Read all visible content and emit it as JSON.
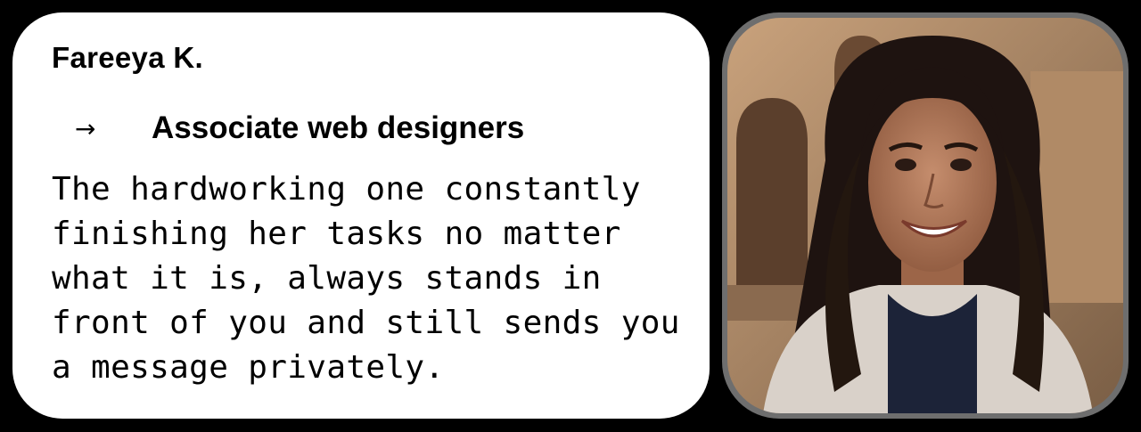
{
  "profile": {
    "name": "Fareeya K.",
    "arrow": "→",
    "role": "Associate web designers",
    "bio": "The hardworking one constantly finishing her tasks no matter what it is, always stands in front of you and still sends you a message privately."
  },
  "photo": {
    "alt": "Portrait photo of a smiling woman with long dark hair",
    "frame_color": "#6e6e6e"
  },
  "colors": {
    "background": "#000000",
    "card": "#ffffff",
    "text": "#000000"
  }
}
